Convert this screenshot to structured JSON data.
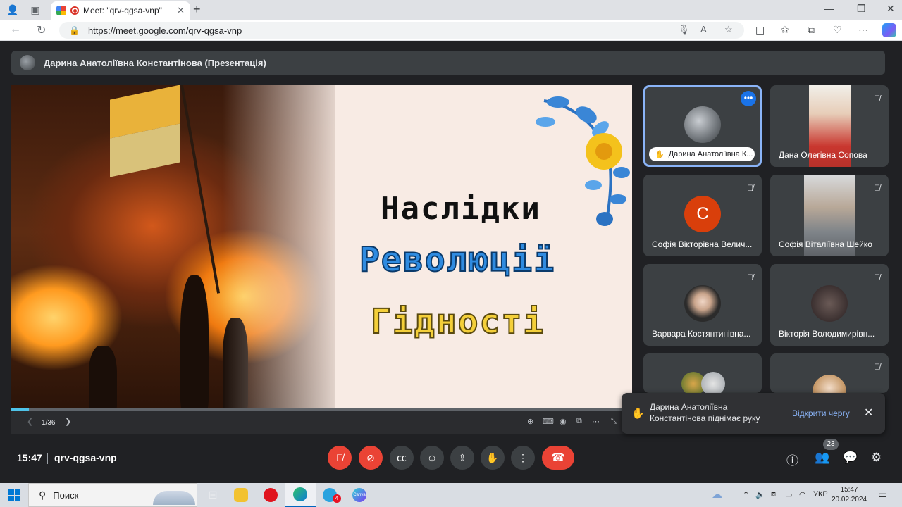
{
  "browser": {
    "tab_title": "Meet: \"qrv-qgsa-vnp\"",
    "url": "https://meet.google.com/qrv-qgsa-vnp"
  },
  "meet": {
    "presenter_label": "Дарина Анатоліївна Константінова (Презентація)",
    "slide": {
      "line1": "Наслідки",
      "line2": "Революції",
      "line3": "Гідності",
      "page_indicator": "1/36",
      "progress_fraction": 0.028
    },
    "participants": [
      {
        "name": "Дарина Анатоліївна К...",
        "type": "avatar",
        "avatar_icon": "cat-avatar",
        "active": true,
        "raised_hand": true
      },
      {
        "name": "Дана Олегівна Сопова",
        "type": "video",
        "muted": true
      },
      {
        "name": "Софія Вікторівна Велич...",
        "type": "letter",
        "letter": "С",
        "letter_color": "#d93f0b",
        "muted": true
      },
      {
        "name": "Софія Віталіївна Шейко",
        "type": "video",
        "muted": true
      },
      {
        "name": "Варвара Костянтинівна...",
        "type": "avatar",
        "muted": true
      },
      {
        "name": "Вікторія Володимирівн...",
        "type": "avatar",
        "muted": true
      }
    ],
    "toast": {
      "message": "Дарина Анатоліївна Константінова піднімає руку",
      "action": "Відкрити чергу"
    },
    "bottom": {
      "time": "15:47",
      "meeting_code": "qrv-qgsa-vnp",
      "participant_count": "23"
    }
  },
  "taskbar": {
    "search_label": "Поиск",
    "telegram_badge": "4",
    "canva_label": "Canva",
    "language": "УКР",
    "time": "15:47",
    "date": "20.02.2024"
  },
  "colors": {
    "meet_bg": "#202124",
    "tile_bg": "#3c4043",
    "danger": "#ea4335",
    "accent": "#8ab4f8"
  }
}
